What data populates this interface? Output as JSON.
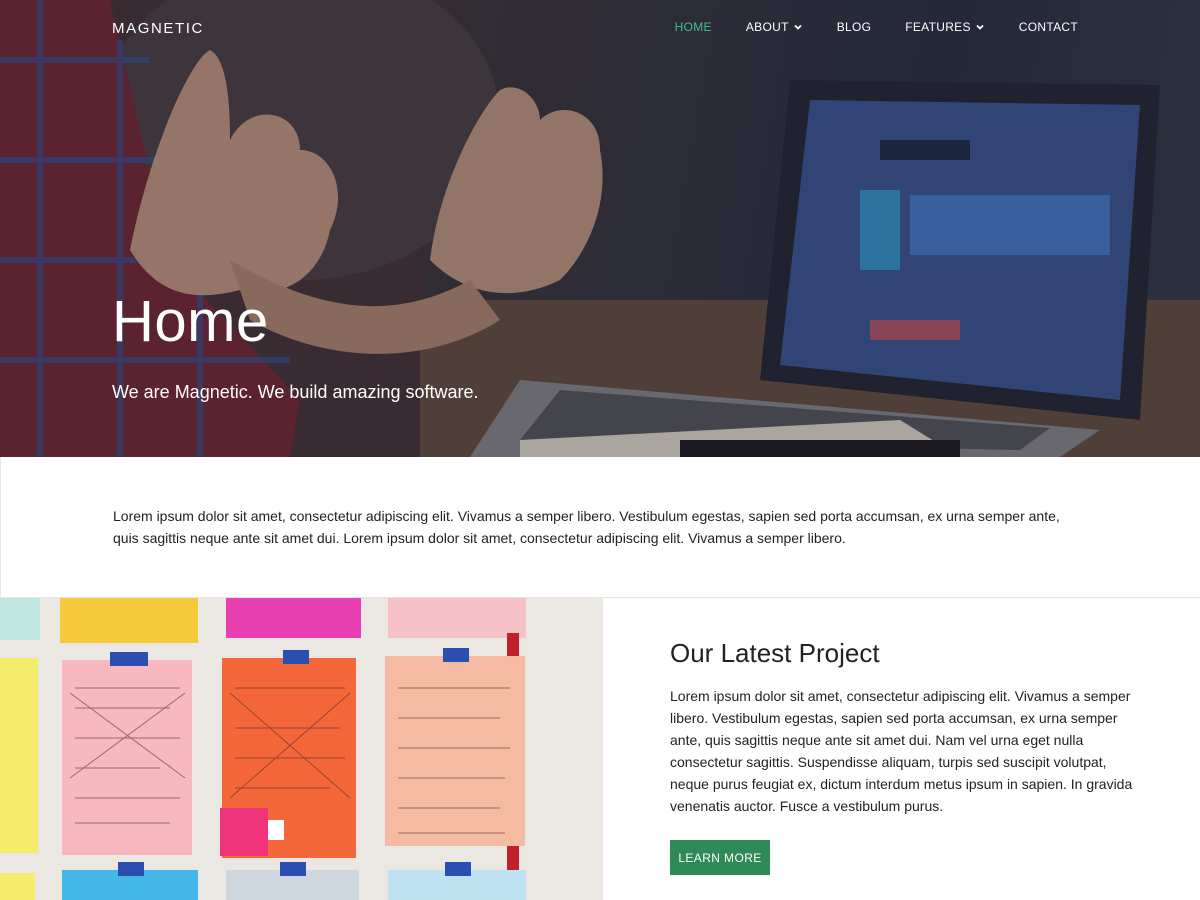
{
  "nav": {
    "brand": "MAGNETIC",
    "items": [
      {
        "label": "HOME",
        "active": true,
        "dropdown": false
      },
      {
        "label": "ABOUT",
        "active": false,
        "dropdown": true
      },
      {
        "label": "BLOG",
        "active": false,
        "dropdown": false
      },
      {
        "label": "FEATURES",
        "active": false,
        "dropdown": true
      },
      {
        "label": "CONTACT",
        "active": false,
        "dropdown": false
      }
    ],
    "active_color": "#3fbf8f"
  },
  "hero": {
    "title": "Home",
    "subtitle": "We are Magnetic. We build amazing software."
  },
  "intro": {
    "text": "Lorem ipsum dolor sit amet, consectetur adipiscing elit. Vivamus a semper libero. Vestibulum egestas, sapien sed porta accumsan, ex urna semper ante, quis sagittis neque ante sit amet dui. Lorem ipsum dolor sit amet, consectetur adipiscing elit. Vivamus a semper libero."
  },
  "project": {
    "title": "Our Latest Project",
    "body": "Lorem ipsum dolor sit amet, consectetur adipiscing elit. Vivamus a semper libero. Vestibulum egestas, sapien sed porta accumsan, ex urna semper ante, quis sagittis neque ante sit amet dui. Nam vel urna eget nulla consectetur sagittis. Suspendisse aliquam, turpis sed suscipit volutpat, neque purus feugiat ex, dictum interdum metus ipsum in sapien. In gravida venenatis auctor. Fusce a vestibulum purus.",
    "button_label": "LEARN MORE",
    "button_color": "#2e8b57"
  }
}
